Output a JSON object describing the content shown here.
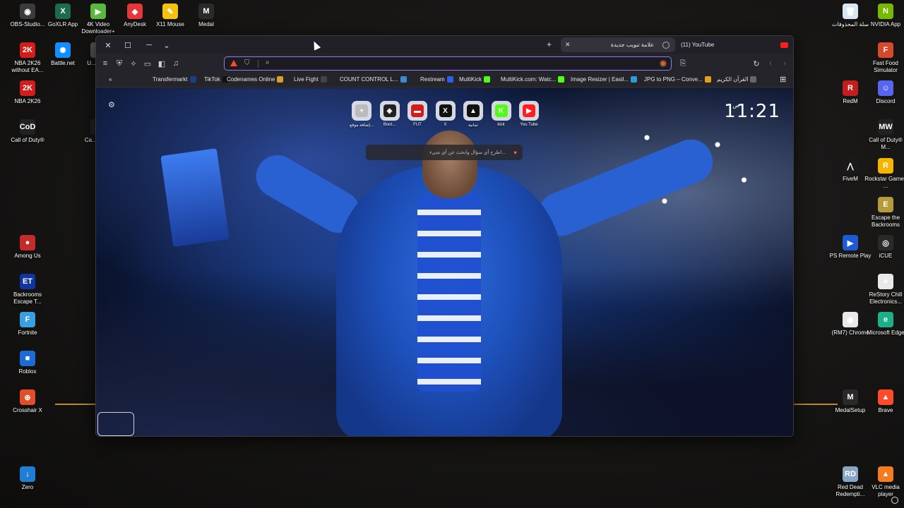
{
  "desktop": {
    "left_icons": [
      {
        "label": "OBS-Studio...",
        "color": "#3b3b3b",
        "glyph": "◉"
      },
      {
        "label": "GoXLR App",
        "color": "#1b6b4c",
        "glyph": "X"
      },
      {
        "label": "4K Video Downloader+",
        "color": "#5bb83e",
        "glyph": "▶"
      },
      {
        "label": "AnyDesk",
        "color": "#e5363a",
        "glyph": "◆"
      },
      {
        "label": "X11 Mouse",
        "color": "#f4c20d",
        "glyph": "✎"
      },
      {
        "label": "Medal",
        "color": "#2a2a2a",
        "glyph": "M"
      },
      {
        "label": "NBA 2K26 without EA...",
        "color": "#d31d1d",
        "glyph": "2K"
      },
      {
        "label": "Battle.net",
        "color": "#148eff",
        "glyph": "✺"
      },
      {
        "label": "U... Co...",
        "color": "#555",
        "glyph": ""
      },
      {
        "label": "NBA 2K26",
        "color": "#d31d1d",
        "glyph": "2K"
      },
      {
        "label": "Call of Duty®",
        "color": "#222",
        "glyph": "CoD"
      },
      {
        "label": "Ca... Dut...",
        "color": "#222",
        "glyph": ""
      },
      {
        "label": "Among Us",
        "color": "#c62b2b",
        "glyph": "●"
      },
      {
        "label": "Backrooms Escape T...",
        "color": "#1234a0",
        "glyph": "ET"
      },
      {
        "label": "Fortnite",
        "color": "#3a9fe0",
        "glyph": "F"
      },
      {
        "label": "Roblox",
        "color": "#1e6bd6",
        "glyph": "■"
      },
      {
        "label": "Crosshair X",
        "color": "#e14f2a",
        "glyph": "⊕"
      },
      {
        "label": "Zero",
        "color": "#1e7fd4",
        "glyph": "↓"
      }
    ],
    "right_icons": [
      {
        "label": "سلة المحذوفات",
        "color": "#d9e6f2",
        "glyph": "🗑"
      },
      {
        "label": "NVIDIA App",
        "color": "#76b900",
        "glyph": "N"
      },
      {
        "label": "Fast Food Simulator",
        "color": "#d64a2b",
        "glyph": "F"
      },
      {
        "label": "RedM",
        "color": "#c21e1e",
        "glyph": "R"
      },
      {
        "label": "Discord",
        "color": "#5865f2",
        "glyph": "☺"
      },
      {
        "label": "Call of Duty® M...",
        "color": "#222",
        "glyph": "MW"
      },
      {
        "label": "FiveM",
        "color": "#1a1a1a",
        "glyph": "⋀"
      },
      {
        "label": "Rockstar Games ...",
        "color": "#f4b400",
        "glyph": "R"
      },
      {
        "label": "Escape the Backrooms",
        "color": "#b59b3a",
        "glyph": "E"
      },
      {
        "label": "PS Remote Play",
        "color": "#1e5ad6",
        "glyph": "▶"
      },
      {
        "label": "iCUE",
        "color": "#2a2a2a",
        "glyph": "◎"
      },
      {
        "label": "ReStory Chill Electronics...",
        "color": "#e8e8e8",
        "glyph": "⟡"
      },
      {
        "label": "(RM7) Chrome",
        "color": "#e8e8e8",
        "glyph": "◉"
      },
      {
        "label": "Microsoft Edge",
        "color": "#1bb08a",
        "glyph": "e"
      },
      {
        "label": "MedalSetup",
        "color": "#2a2a2a",
        "glyph": "M"
      },
      {
        "label": "Brave",
        "color": "#ff4b2b",
        "glyph": "▲"
      },
      {
        "label": "Red Dead Redempti...",
        "color": "#8aa6c6",
        "glyph": "RD"
      },
      {
        "label": "VLC media player",
        "color": "#f47b20",
        "glyph": "▲"
      }
    ]
  },
  "browser": {
    "tabs": [
      {
        "title": "علامة تبويب جديدة",
        "active": true
      },
      {
        "title": "(11) YouTube",
        "active": false
      }
    ],
    "address": {
      "value": "",
      "placeholder": ""
    },
    "bookmarks": [
      {
        "label": "Transfermarkt",
        "color": "#1a3e8a",
        "glyph": "tm"
      },
      {
        "label": "TikTok",
        "color": "#111",
        "glyph": "♪"
      },
      {
        "label": "Codenames Online",
        "color": "#d6a12b",
        "glyph": ""
      },
      {
        "label": "Live Fight",
        "color": "#444",
        "glyph": ""
      },
      {
        "label": "COUNT CONTROL L...",
        "color": "#3a8ad6",
        "glyph": ""
      },
      {
        "label": "Restream",
        "color": "#2b60e8",
        "glyph": "R"
      },
      {
        "label": "MultiKick",
        "color": "#53fc18",
        "glyph": "K"
      },
      {
        "label": "MultiKick.com: Watc...",
        "color": "#53fc18",
        "glyph": "MK"
      },
      {
        "label": "Image Resizer | Easil...",
        "color": "#2b9bd6",
        "glyph": ""
      },
      {
        "label": "JPG to PNG – Conve...",
        "color": "#e0a020",
        "glyph": ""
      },
      {
        "label": "القرآن الكريم",
        "color": "#666",
        "glyph": ""
      }
    ],
    "new_tab": {
      "clock": "11:21",
      "ampm": "ص",
      "ask_placeholder": "اطرح أي سؤال وابحث عن أي شيء...",
      "top_sites": [
        {
          "label": "إضافة موقع...",
          "color": "#bbb",
          "glyph": "+"
        },
        {
          "label": "Boot...",
          "color": "#222",
          "glyph": "◈"
        },
        {
          "label": "FUT",
          "color": "#d31d1d",
          "glyph": "▬"
        },
        {
          "label": "X",
          "color": "#111",
          "glyph": "X"
        },
        {
          "label": "ثمانية",
          "color": "#111",
          "glyph": "▲"
        },
        {
          "label": "kick",
          "color": "#53fc18",
          "glyph": "K"
        },
        {
          "label": "You Tube",
          "color": "#ff1d1d",
          "glyph": "▶"
        }
      ]
    }
  }
}
